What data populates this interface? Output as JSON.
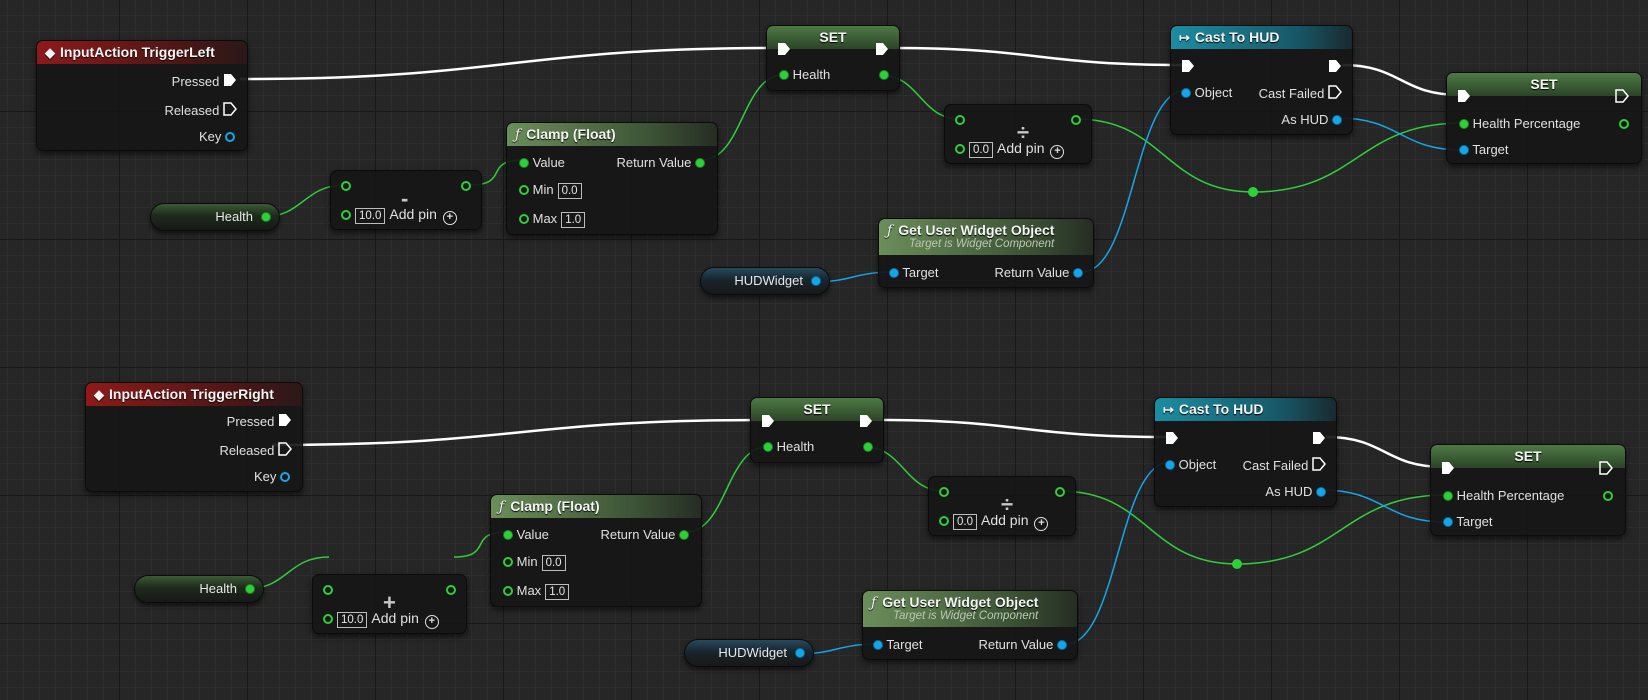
{
  "graphs": [
    {
      "event": {
        "title": "InputAction TriggerLeft",
        "pressed": "Pressed",
        "released": "Released",
        "key": "Key"
      },
      "health_var": "Health",
      "op_symbol": "-",
      "op_literal": "10.0",
      "op_add_pin": "Add pin",
      "clamp": {
        "title": "Clamp (Float)",
        "value": "Value",
        "return": "Return Value",
        "min": "Min",
        "min_val": "0.0",
        "max": "Max",
        "max_val": "1.0"
      },
      "set1": {
        "title": "SET",
        "pin": "Health"
      },
      "divide": {
        "symbol": "÷",
        "literal": "0.0",
        "add_pin": "Add pin"
      },
      "widget_var": "HUDWidget",
      "get_widget": {
        "title": "Get User Widget Object",
        "subtitle": "Target is Widget Component",
        "target": "Target",
        "return": "Return Value"
      },
      "cast": {
        "title": "Cast To HUD",
        "object": "Object",
        "failed": "Cast Failed",
        "as_hud": "As HUD"
      },
      "set2": {
        "title": "SET",
        "pin1": "Health Percentage",
        "pin2": "Target"
      }
    },
    {
      "event": {
        "title": "InputAction TriggerRight",
        "pressed": "Pressed",
        "released": "Released",
        "key": "Key"
      },
      "health_var": "Health",
      "op_symbol": "+",
      "op_literal": "10.0",
      "op_add_pin": "Add pin",
      "clamp": {
        "title": "Clamp (Float)",
        "value": "Value",
        "return": "Return Value",
        "min": "Min",
        "min_val": "0.0",
        "max": "Max",
        "max_val": "1.0"
      },
      "set1": {
        "title": "SET",
        "pin": "Health"
      },
      "divide": {
        "symbol": "÷",
        "literal": "0.0",
        "add_pin": "Add pin"
      },
      "widget_var": "HUDWidget",
      "get_widget": {
        "title": "Get User Widget Object",
        "subtitle": "Target is Widget Component",
        "target": "Target",
        "return": "Return Value"
      },
      "cast": {
        "title": "Cast To HUD",
        "object": "Object",
        "failed": "Cast Failed",
        "as_hud": "As HUD"
      },
      "set2": {
        "title": "SET",
        "pin1": "Health Percentage",
        "pin2": "Target"
      }
    }
  ],
  "colors": {
    "exec_wire": "#ffffff",
    "float_wire": "#2fcf3a",
    "object_wire": "#15a6e8",
    "event_header": "#8e1a1a",
    "function_header": "#6b8e5a",
    "cast_header": "#1c8da1"
  }
}
